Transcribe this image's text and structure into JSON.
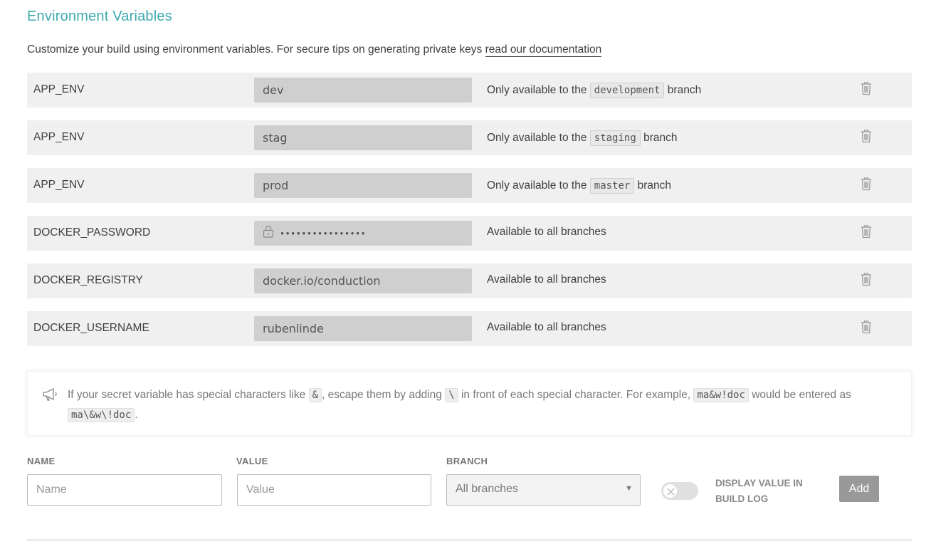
{
  "section": {
    "title": "Environment Variables",
    "intro_text": "Customize your build using environment variables. For secure tips on generating private keys ",
    "doc_link": "read our documentation"
  },
  "variables": [
    {
      "name": "APP_ENV",
      "value": "dev",
      "availability_prefix": "Only available to the ",
      "branch": "development",
      "availability_suffix": " branch",
      "secret": false
    },
    {
      "name": "APP_ENV",
      "value": "stag",
      "availability_prefix": "Only available to the ",
      "branch": "staging",
      "availability_suffix": " branch",
      "secret": false
    },
    {
      "name": "APP_ENV",
      "value": "prod",
      "availability_prefix": "Only available to the ",
      "branch": "master",
      "availability_suffix": " branch",
      "secret": false
    },
    {
      "name": "DOCKER_PASSWORD",
      "value": "••••••••••••••••",
      "availability_prefix": "Available to all branches",
      "branch": "",
      "availability_suffix": "",
      "secret": true
    },
    {
      "name": "DOCKER_REGISTRY",
      "value": "docker.io/conduction",
      "availability_prefix": "Available to all branches",
      "branch": "",
      "availability_suffix": "",
      "secret": false
    },
    {
      "name": "DOCKER_USERNAME",
      "value": "rubenlinde",
      "availability_prefix": "Available to all branches",
      "branch": "",
      "availability_suffix": "",
      "secret": false
    }
  ],
  "notice": {
    "icon": "megaphone-icon",
    "part1": "If your secret variable has special characters like ",
    "code1": "&",
    "part2": ", escape them by adding ",
    "code2": "\\",
    "part3": " in front of each special character. For example, ",
    "code3": "ma&w!doc",
    "part4": " would be entered as ",
    "code4": "ma\\&w\\!doc",
    "part5": "."
  },
  "form": {
    "name_label": "NAME",
    "name_placeholder": "Name",
    "value_label": "VALUE",
    "value_placeholder": "Value",
    "branch_label": "BRANCH",
    "branch_selected": "All branches",
    "display_toggle_label": "DISPLAY VALUE IN BUILD LOG",
    "display_toggle_on": false,
    "add_label": "Add"
  },
  "colors": {
    "accent": "#3eaaaf",
    "row_bg": "#f0f0f0",
    "value_bg": "#cfcfcf",
    "button_bg": "#999999"
  }
}
